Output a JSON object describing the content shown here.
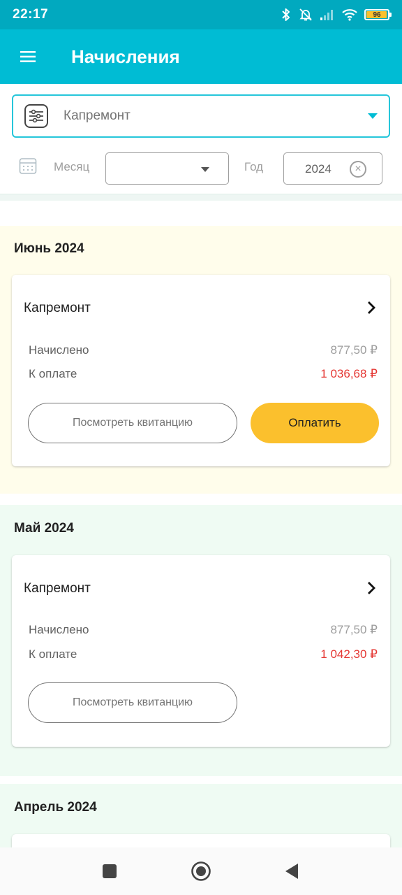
{
  "status_bar": {
    "time": "22:17",
    "battery_level": "96",
    "battery_fraction": 0.96,
    "icons": [
      "bluetooth-icon",
      "bell-off-icon",
      "signal-icon",
      "wifi-icon",
      "battery-icon"
    ]
  },
  "app_bar": {
    "title": "Начисления",
    "menu_icon": "hamburger-menu-icon"
  },
  "filters": {
    "category": "Капремонт",
    "month_label": "Месяц",
    "month_value": "",
    "year_label": "Год",
    "year_value": "2024"
  },
  "sections": [
    {
      "title": "Июнь 2024",
      "card": {
        "name": "Капремонт",
        "accrued_label": "Начислено",
        "accrued_value": "877,50 ₽",
        "due_label": "К оплате",
        "due_value": "1 036,68 ₽",
        "receipt_button": "Посмотреть квитанцию",
        "pay_button": "Оплатить"
      }
    },
    {
      "title": "Май 2024",
      "card": {
        "name": "Капремонт",
        "accrued_label": "Начислено",
        "accrued_value": "877,50 ₽",
        "due_label": "К оплате",
        "due_value": "1 042,30 ₽",
        "receipt_button": "Посмотреть квитанцию"
      }
    },
    {
      "title": "Апрель 2024"
    }
  ],
  "colors": {
    "status_bar": "#01a9bf",
    "app_bar": "#00bcd4",
    "accent": "#26c6da",
    "pay_button": "#fbc02d",
    "due_amount": "#e53935",
    "section_current": "#fffdeb",
    "section_past": "#effbf3"
  },
  "nav_bar": {
    "icons": [
      "recents-square-icon",
      "home-circle-icon",
      "back-triangle-icon"
    ]
  }
}
